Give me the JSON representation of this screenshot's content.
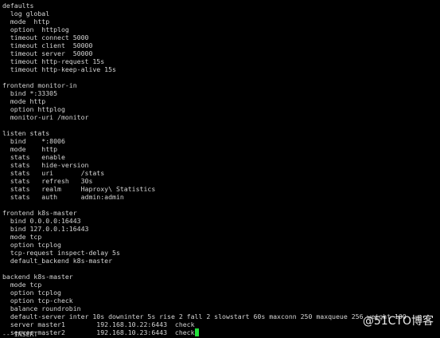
{
  "terminal": {
    "lines": [
      "defaults",
      "  log global",
      "  mode  http",
      "  option  httplog",
      "  timeout connect 5000",
      "  timeout client  50000",
      "  timeout server  50000",
      "  timeout http-request 15s",
      "  timeout http-keep-alive 15s",
      "",
      "frontend monitor-in",
      "  bind *:33305",
      "  mode http",
      "  option httplog",
      "  monitor-uri /monitor",
      "",
      "listen stats",
      "  bind    *:8006",
      "  mode    http",
      "  stats   enable",
      "  stats   hide-version",
      "  stats   uri       /stats",
      "  stats   refresh   30s",
      "  stats   realm     Haproxy\\ Statistics",
      "  stats   auth      admin:admin",
      "",
      "frontend k8s-master",
      "  bind 0.0.0.0:16443",
      "  bind 127.0.0.1:16443",
      "  mode tcp",
      "  option tcplog",
      "  tcp-request inspect-delay 5s",
      "  default_backend k8s-master",
      "",
      "backend k8s-master",
      "  mode tcp",
      "  option tcplog",
      "  option tcp-check",
      "  balance roundrobin",
      "  default-server inter 10s downinter 5s rise 2 fall 2 slowstart 60s maxconn 250 maxqueue 256 weight 100",
      "  server master1        192.168.10.22:6443  check",
      "  server master2        192.168.10.23:6443  check"
    ],
    "status": "-- INSERT --",
    "cursor_color": "#22e03a",
    "text_color": "#d4d4d4",
    "background": "#000000"
  },
  "watermark": {
    "text": "@51CTO博客"
  }
}
